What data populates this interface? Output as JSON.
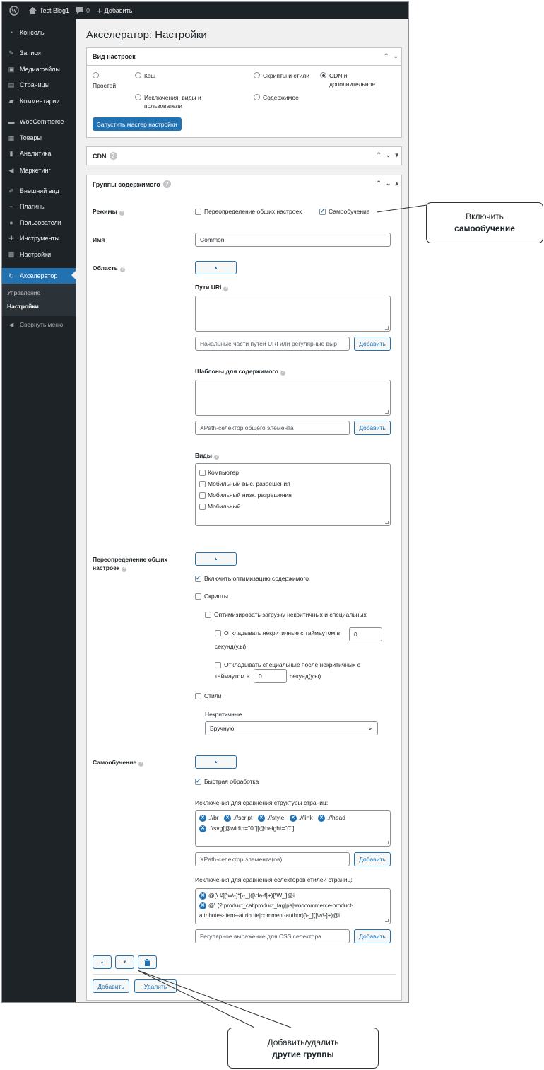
{
  "admin_bar": {
    "site_name": "Test Blog1",
    "comments_count": "0",
    "new_label": "Добавить"
  },
  "sidebar": {
    "items": [
      {
        "label": "Консоль",
        "icon": "dashboard-icon"
      },
      {
        "label": "Записи",
        "icon": "pin-icon"
      },
      {
        "label": "Медиафайлы",
        "icon": "media-icon"
      },
      {
        "label": "Страницы",
        "icon": "page-icon"
      },
      {
        "label": "Комментарии",
        "icon": "comment-icon"
      },
      {
        "label": "WooCommerce",
        "icon": "woocommerce-icon"
      },
      {
        "label": "Товары",
        "icon": "archive-icon"
      },
      {
        "label": "Аналитика",
        "icon": "chart-icon"
      },
      {
        "label": "Маркетинг",
        "icon": "megaphone-icon"
      },
      {
        "label": "Внешний вид",
        "icon": "brush-icon"
      },
      {
        "label": "Плагины",
        "icon": "plugin-icon"
      },
      {
        "label": "Пользователи",
        "icon": "user-icon"
      },
      {
        "label": "Инструменты",
        "icon": "wrench-icon"
      },
      {
        "label": "Настройки",
        "icon": "settings-icon"
      },
      {
        "label": "Акселератор",
        "icon": "accelerator-icon"
      }
    ],
    "submenu": [
      "Управление",
      "Настройки"
    ],
    "collapse_label": "Свернуть меню"
  },
  "page": {
    "title": "Акселератор: Настройки"
  },
  "settings_view": {
    "title": "Вид настроек",
    "options": [
      "Простой",
      "Кэш",
      "Скрипты и стили",
      "CDN и дополнительное",
      "Исключения, виды и пользователи",
      "Содержимое"
    ],
    "selected": "CDN и дополнительное",
    "wizard_button": "Запустить мастер настройки"
  },
  "cdn": {
    "title": "CDN"
  },
  "groups": {
    "title": "Группы содержимого",
    "modes": {
      "label": "Режимы",
      "override_label": "Переопределение общих настроек",
      "override_checked": false,
      "selflearn_label": "Самообучение",
      "selflearn_checked": true
    },
    "name": {
      "label": "Имя",
      "value": "Common"
    },
    "area": {
      "label": "Область",
      "toggle": "▲",
      "uri_label": "Пути URI",
      "uri_placeholder": "Начальные части путей URI или регулярные выр",
      "templates_label": "Шаблоны для содержимого",
      "xpath_placeholder": "XPath-селектор общего элемента",
      "add_label": "Добавить",
      "views_label": "Виды",
      "views": [
        "Компьютер",
        "Мобильный выс. разрешения",
        "Мобильный низк. разрешения",
        "Мобильный"
      ]
    },
    "override": {
      "label_line1": "Переопределение общих",
      "label_line2": "настроек",
      "toggle": "▲",
      "enable_opt": "Включить оптимизацию содержимого",
      "enable_opt_checked": true,
      "scripts": "Скрипты",
      "optimize_load": "Оптимизировать загрузку некритичных и специальных",
      "delay_noncrit_1": "Откладывать некритичные с таймаутом в",
      "delay_noncrit_value": "0",
      "delay_noncrit_2": "секунд(у,ы)",
      "delay_special_1": "Откладывать специальные после некритичных с",
      "delay_special_2": "таймаутом в",
      "delay_special_value": "0",
      "delay_special_3": "секунд(у,ы)",
      "styles": "Стили",
      "noncritical_label": "Некритичные",
      "noncritical_value": "Вручную"
    },
    "selflearn": {
      "label": "Самообучение",
      "toggle": "▲",
      "fast": "Быстрая обработка",
      "fast_checked": true,
      "struct_label": "Исключения для сравнения структуры страниц:",
      "struct_items": [
        ".//br",
        ".//script",
        ".//style",
        ".//link",
        ".//head",
        ".//svg[@width=\"0\"][@height=\"0\"]"
      ],
      "xpath_placeholder": "XPath-селектор элемента(ов)",
      "css_label": "Исключения для сравнения селекторов стилей страниц:",
      "css_item1": "@[\\.#][\\w\\-]*[\\-_]([\\da-f]+)[\\W_]@i",
      "css_item2_line1": "@\\.(?:product_cat|product_tag|pa|woocommerce-product-",
      "css_item2_line2": "attributes-item--attribute|comment-author)[\\-_]([\\w\\-]+)@i",
      "css_placeholder": "Регулярное выражение для CSS селектора"
    },
    "move_up": "▲",
    "move_down": "▼",
    "add_button": "Добавить",
    "delete_button": "Удалить"
  },
  "callouts": {
    "selflearn_line1": "Включить",
    "selflearn_line2": "самообучение",
    "groups_line1": "Добавить/удалить",
    "groups_line2": "другие группы"
  }
}
